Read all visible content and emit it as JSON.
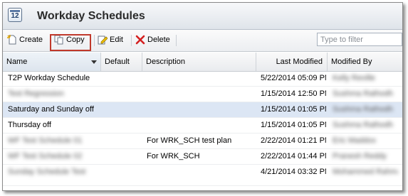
{
  "app": {
    "title": "Workday Schedules",
    "icon_text": "12"
  },
  "toolbar": {
    "create_label": "Create",
    "copy_label": "Copy",
    "edit_label": "Edit",
    "delete_label": "Delete",
    "filter_placeholder": "Type to filter",
    "filter_value": ""
  },
  "columns": {
    "name": "Name",
    "default": "Default",
    "description": "Description",
    "last_modified": "Last Modified",
    "modified_by": "Modified By"
  },
  "rows": [
    {
      "name": "T2P Workday Schedule",
      "description": "",
      "last_modified": "5/22/2014 05:09 PM",
      "modified_by": "Kelly Reville",
      "selected": false,
      "name_obscured": false
    },
    {
      "name": "Test Regression",
      "description": "",
      "last_modified": "1/15/2014 12:50 PM",
      "modified_by": "Sushma Rathodh",
      "selected": false,
      "name_obscured": true
    },
    {
      "name": "Saturday and Sunday off",
      "description": "",
      "last_modified": "1/15/2014 01:05 PM",
      "modified_by": "Sushma Rathodh",
      "selected": true,
      "name_obscured": false
    },
    {
      "name": "Thursday off",
      "description": "",
      "last_modified": "1/15/2014 01:05 PM",
      "modified_by": "Sushma Rathodh",
      "selected": false,
      "name_obscured": false
    },
    {
      "name": "WF Test Schedule 01",
      "description": "For WRK_SCH test plan",
      "last_modified": "2/22/2014 01:21 PM",
      "modified_by": "Eric Maddox",
      "selected": false,
      "name_obscured": true
    },
    {
      "name": "WF Test Schedule 02",
      "description": "For WRK_SCH",
      "last_modified": "2/22/2014 01:44 PM",
      "modified_by": "Pranesh Reddy",
      "selected": false,
      "name_obscured": true
    },
    {
      "name": "Sunday Schedule Test",
      "description": "",
      "last_modified": "4/21/2014 03:32 PM",
      "modified_by": "Mohammed Rahman",
      "selected": false,
      "name_obscured": true
    }
  ]
}
